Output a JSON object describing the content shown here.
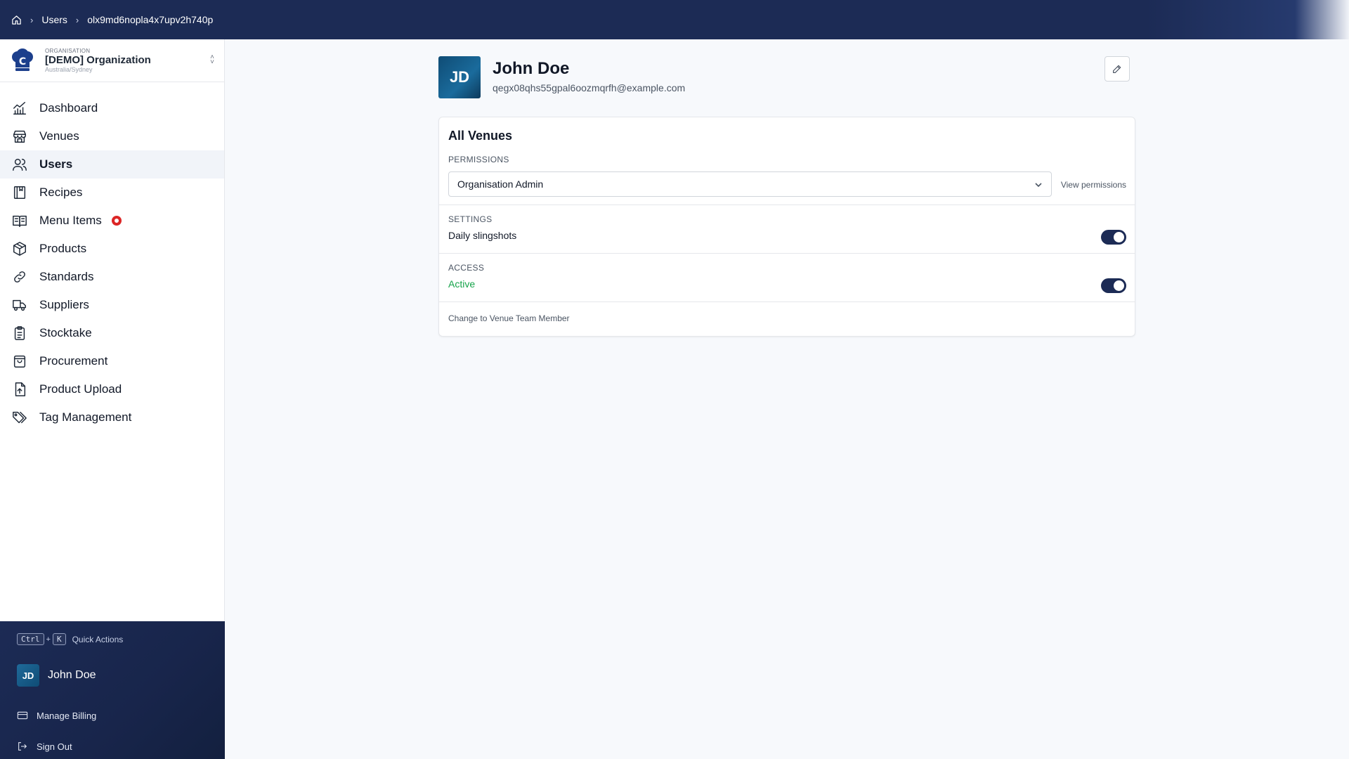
{
  "breadcrumb": {
    "items": [
      "Users",
      "olx9md6nopla4x7upv2h740p"
    ]
  },
  "org": {
    "kicker": "Organisation",
    "name": "[DEMO] Organization",
    "timezone": "Australia/Sydney"
  },
  "nav": {
    "items": [
      {
        "label": "Dashboard",
        "icon": "chart-icon"
      },
      {
        "label": "Venues",
        "icon": "store-icon"
      },
      {
        "label": "Users",
        "icon": "users-icon",
        "active": true
      },
      {
        "label": "Recipes",
        "icon": "book-icon"
      },
      {
        "label": "Menu Items",
        "icon": "open-book-icon",
        "badge": true
      },
      {
        "label": "Products",
        "icon": "boxes-icon"
      },
      {
        "label": "Standards",
        "icon": "link-icon"
      },
      {
        "label": "Suppliers",
        "icon": "truck-icon"
      },
      {
        "label": "Stocktake",
        "icon": "clipboard-icon"
      },
      {
        "label": "Procurement",
        "icon": "bag-icon"
      },
      {
        "label": "Product Upload",
        "icon": "upload-file-icon"
      },
      {
        "label": "Tag Management",
        "icon": "tags-icon"
      }
    ]
  },
  "footer": {
    "kbd_ctrl": "Ctrl",
    "kbd_plus": "+",
    "kbd_k": "K",
    "quick_actions": "Quick Actions",
    "user_initials": "JD",
    "user_name": "John Doe",
    "manage_billing": "Manage Billing",
    "sign_out": "Sign Out"
  },
  "profile": {
    "initials": "JD",
    "name": "John Doe",
    "email": "qegx08qhs55gpal6oozmqrfh@example.com"
  },
  "card": {
    "title": "All Venues",
    "permissions_label": "PERMISSIONS",
    "permission_value": "Organisation Admin",
    "view_permissions": "View permissions",
    "settings_label": "SETTINGS",
    "setting_name": "Daily slingshots",
    "setting_on": true,
    "access_label": "ACCESS",
    "access_status": "Active",
    "access_on": true,
    "change_link": "Change to Venue Team Member"
  },
  "colors": {
    "brand": "#1c2b55",
    "active_green": "#16a34a",
    "badge_red": "#dc2626"
  }
}
